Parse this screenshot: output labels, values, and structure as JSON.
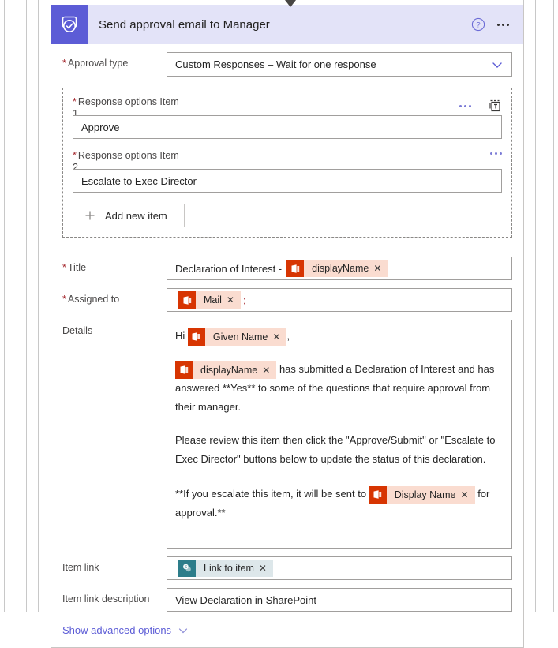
{
  "card": {
    "header": {
      "title": "Send approval email to Manager",
      "icon": "approvals-icon",
      "help_icon": "help-circle-icon",
      "more_icon": "ellipsis-icon"
    },
    "approval_type": {
      "label": "Approval type",
      "required": true,
      "value": "Custom Responses – Wait for one response",
      "chevron_icon": "chevron-down-icon"
    },
    "response_options": {
      "delete_icon": "delete-icon",
      "items": [
        {
          "label": "Response options Item",
          "number": "1",
          "required": true,
          "value": "Approve",
          "more_icon": "ellipsis-icon"
        },
        {
          "label": "Response options Item",
          "number": "2",
          "required": true,
          "value": "Escalate to Exec Director",
          "more_icon": "ellipsis-icon"
        }
      ],
      "add_button": {
        "label": "Add new item",
        "icon": "plus-icon"
      }
    },
    "title_field": {
      "label": "Title",
      "required": true,
      "text": "Declaration of Interest -",
      "token": {
        "text": "displayName",
        "icon": "office365-outlook-icon",
        "remove_icon": "close-icon"
      }
    },
    "assigned_to": {
      "label": "Assigned to",
      "required": true,
      "token": {
        "text": "Mail",
        "icon": "office365-outlook-icon",
        "remove_icon": "close-icon"
      },
      "trailing_text": ";"
    },
    "details": {
      "label": "Details",
      "required": false,
      "greeting_prefix": "Hi",
      "greeting_token": {
        "text": "Given Name",
        "icon": "office365-outlook-icon",
        "remove_icon": "close-icon"
      },
      "greeting_suffix": ",",
      "para1_token": {
        "text": "displayName",
        "icon": "office365-outlook-icon",
        "remove_icon": "close-icon"
      },
      "para1_text": "has submitted a Declaration of Interest and has answered **Yes** to some of the questions that require approval from their manager.",
      "para2_text": "Please review this item then click the \"Approve/Submit\" or \"Escalate to Exec Director\" buttons below to update the status of this declaration.",
      "para3_prefix": "**If you escalate this item, it will be sent to",
      "para3_token": {
        "text": "Display Name",
        "icon": "office365-outlook-icon",
        "remove_icon": "close-icon"
      },
      "para3_suffix": "for approval.**"
    },
    "item_link": {
      "label": "Item link",
      "required": false,
      "token": {
        "text": "Link to item",
        "icon": "sharepoint-icon",
        "remove_icon": "close-icon"
      }
    },
    "item_link_description": {
      "label": "Item link description",
      "required": false,
      "value": "View Declaration in SharePoint"
    },
    "advanced_options": {
      "label": "Show advanced options",
      "chevron_icon": "chevron-down-icon"
    }
  },
  "colors": {
    "accent_purple": "#5c5cd6",
    "header_band": "#e3e3f8",
    "required_red": "#a4262c",
    "office365_orange": "#d73502",
    "office365_chip": "#fadcd0",
    "sharepoint_teal": "#2d7d8a",
    "sharepoint_chip": "#dde7ea"
  }
}
